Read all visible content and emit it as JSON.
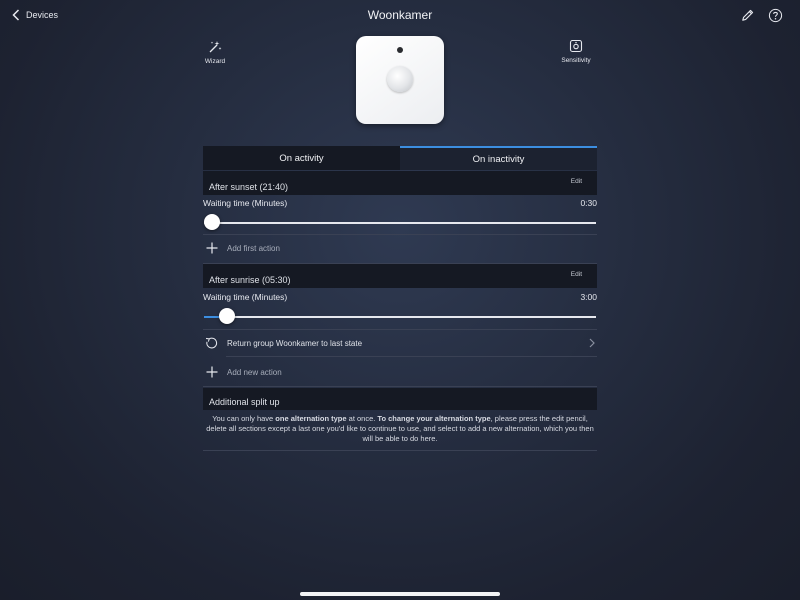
{
  "topbar": {
    "back_label": "Devices",
    "title": "Woonkamer"
  },
  "tools": {
    "wizard_label": "Wizard",
    "sensitivity_label": "Sensitivity"
  },
  "tabs": [
    {
      "label": "On activity"
    },
    {
      "label": "On inactivity",
      "selected": true
    }
  ],
  "sections": [
    {
      "header": "After sunset (21:40)",
      "edit_label": "Edit",
      "waiting_label": "Waiting time (Minutes)",
      "waiting_value": "0:30",
      "slider_fraction": 0.0,
      "add_action_label": "Add first action"
    },
    {
      "header": "After sunrise (05:30)",
      "edit_label": "Edit",
      "waiting_label": "Waiting time (Minutes)",
      "waiting_value": "3:00",
      "slider_fraction": 0.04,
      "existing_action_label": "Return group Woonkamer to last state",
      "add_action_label": "Add new action"
    }
  ],
  "split": {
    "header": "Additional split up",
    "note_1": "You can only have ",
    "note_b1": "one alternation type",
    "note_2": " at once. ",
    "note_b2": "To change your alternation type",
    "note_3": ", please press the edit pencil, delete all sections except a last one you'd like to continue to use, and select to add a new alternation, which you then will be able to do here."
  },
  "colors": {
    "accent": "#3c8ee0",
    "background": "#232a3b",
    "section_bg": "#151923"
  },
  "icons": [
    "chevron-left-icon",
    "pencil-icon",
    "help-icon",
    "wizard-icon",
    "sensitivity-icon",
    "plus-icon",
    "refresh-icon",
    "chevron-right-icon"
  ]
}
